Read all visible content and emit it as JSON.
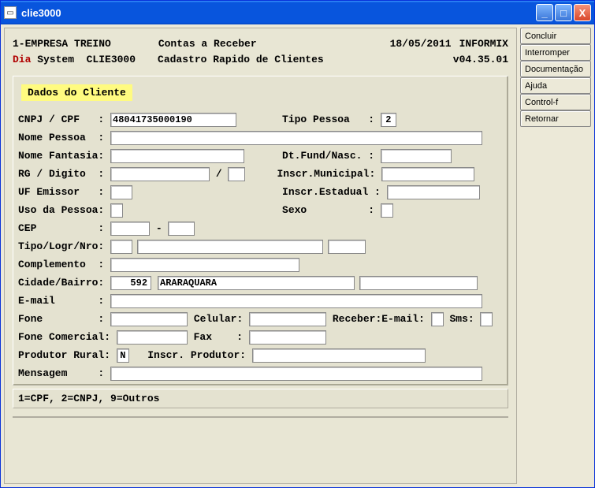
{
  "window": {
    "title": "clie3000"
  },
  "sidebar": {
    "items": [
      {
        "label": "Concluir"
      },
      {
        "label": "Interromper"
      },
      {
        "label": "Documentação"
      },
      {
        "label": "Ajuda"
      },
      {
        "label": "Control-f"
      },
      {
        "label": "Retornar"
      }
    ]
  },
  "header": {
    "company": "1-EMPRESA TREINO",
    "module": "Contas a Receber",
    "date": "18/05/2011",
    "db": "INFORMIX",
    "sys_prefix": "Dia",
    "sys_suffix": " System  CLIE3000",
    "subtitle": "Cadastro Rapido de Clientes",
    "version": "v04.35.01"
  },
  "section": {
    "title": "Dados do Cliente"
  },
  "labels": {
    "cnpj_cpf": "CNPJ / CPF   : ",
    "tipo_pessoa_lbl": "Tipo Pessoa   : ",
    "nome_pessoa": "Nome Pessoa  : ",
    "nome_fantasia": "Nome Fantasia: ",
    "dt_fund": "Dt.Fund/Nasc. : ",
    "rg_digito": "RG / Digito  : ",
    "slash": " / ",
    "inscr_municipal": "Inscr.Municipal: ",
    "uf_emissor": "UF Emissor   : ",
    "inscr_estadual": "Inscr.Estadual : ",
    "uso_pessoa": "Uso da Pessoa: ",
    "sexo": "Sexo          : ",
    "cep": "CEP          : ",
    "cep_dash": " - ",
    "tipo_log": "Tipo/Logr/Nro: ",
    "complemento": "Complemento  : ",
    "cidade_bairro": "Cidade/Bairro: ",
    "email": "E-mail       : ",
    "fone": "Fone         : ",
    "celular": " Celular: ",
    "receber_email": " Receber:E-mail: ",
    "sms": " Sms: ",
    "fone_com": "Fone Comercial: ",
    "fax": " Fax    : ",
    "produtor": "Produtor Rural: ",
    "inscr_produtor": "   Inscr. Produtor: ",
    "mensagem": "Mensagem     : "
  },
  "values": {
    "cnpj_cpf": "48041735000190",
    "tipo_pessoa": "2",
    "nome_pessoa": "",
    "nome_fantasia": "",
    "dt_fund": "",
    "rg": "",
    "digito": "",
    "inscr_municipal": "",
    "uf_emissor": "",
    "inscr_estadual": "",
    "uso_pessoa": "",
    "sexo": "",
    "cep_a": "",
    "cep_b": "",
    "tipo_a": "",
    "tipo_b": "",
    "tipo_c": "",
    "complemento": "",
    "cidade_cod": "592",
    "cidade_nome": "ARARAQUARA",
    "bairro": "",
    "email": "",
    "fone": "",
    "celular": "",
    "rec_email": "",
    "sms": "",
    "fone_com": "",
    "fax": "",
    "produtor": "N",
    "inscr_produtor": "",
    "mensagem": ""
  },
  "statusbar": "1=CPF, 2=CNPJ, 9=Outros"
}
